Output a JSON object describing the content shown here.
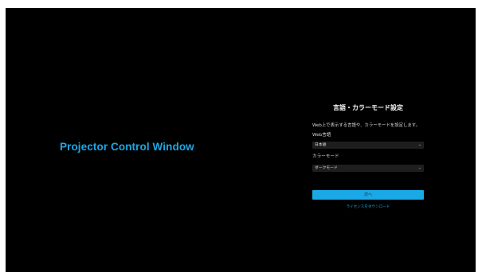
{
  "brand": {
    "title": "Projector Control Window"
  },
  "settings": {
    "title": "言語・カラーモード設定",
    "description": "Web上で表示する言語や、カラーモードを設定します。",
    "language_label": "Web言語",
    "language_value": "日本語",
    "color_mode_label": "カラーモード",
    "color_mode_value": "ダークモード",
    "next_button": "次へ",
    "license_link": "ライセンスをダウンロード"
  },
  "icons": {
    "select_chevron": "chevron-down-icon"
  },
  "colors": {
    "background": "#000000",
    "accent": "#1aa8e6",
    "field_background": "#1e1e1e"
  }
}
